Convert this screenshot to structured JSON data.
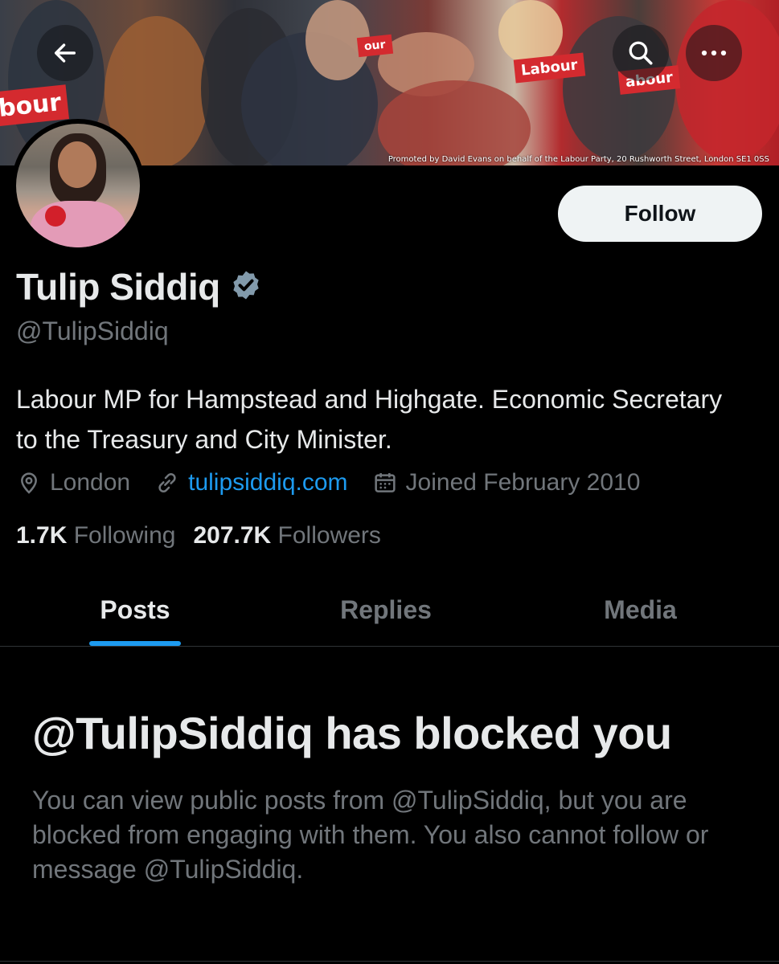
{
  "banner": {
    "promo_text": "Promoted by David Evans on behalf of the Labour Party, 20 Rushworth Street, London SE1 0SS",
    "signs": [
      "bour",
      "Labour",
      "Labour",
      "abour"
    ]
  },
  "header_buttons": {
    "back_icon": "back-arrow-icon",
    "search_icon": "search-icon",
    "more_icon": "more-icon"
  },
  "profile": {
    "follow_label": "Follow",
    "name": "Tulip Siddiq",
    "handle": "@TulipSiddiq",
    "bio": "Labour MP for Hampstead and Highgate. Economic Secretary to the Treasury and City Minister.",
    "location": "London",
    "website": "tulipsiddiq.com",
    "joined": "Joined February 2010",
    "following_count": "1.7K",
    "following_label": "Following",
    "followers_count": "207.7K",
    "followers_label": "Followers"
  },
  "tabs": [
    {
      "label": "Posts",
      "active": true
    },
    {
      "label": "Replies",
      "active": false
    },
    {
      "label": "Media",
      "active": false
    }
  ],
  "blocked": {
    "title": "@TulipSiddiq has blocked you",
    "message": "You can view public posts from @TulipSiddiq, but you are blocked from engaging with them. You also cannot follow or message @TulipSiddiq."
  },
  "colors": {
    "background": "#000000",
    "accent": "#1d9bf0",
    "muted": "#71767b",
    "text": "#e7e9ea",
    "verified_badge": "#829aab"
  }
}
